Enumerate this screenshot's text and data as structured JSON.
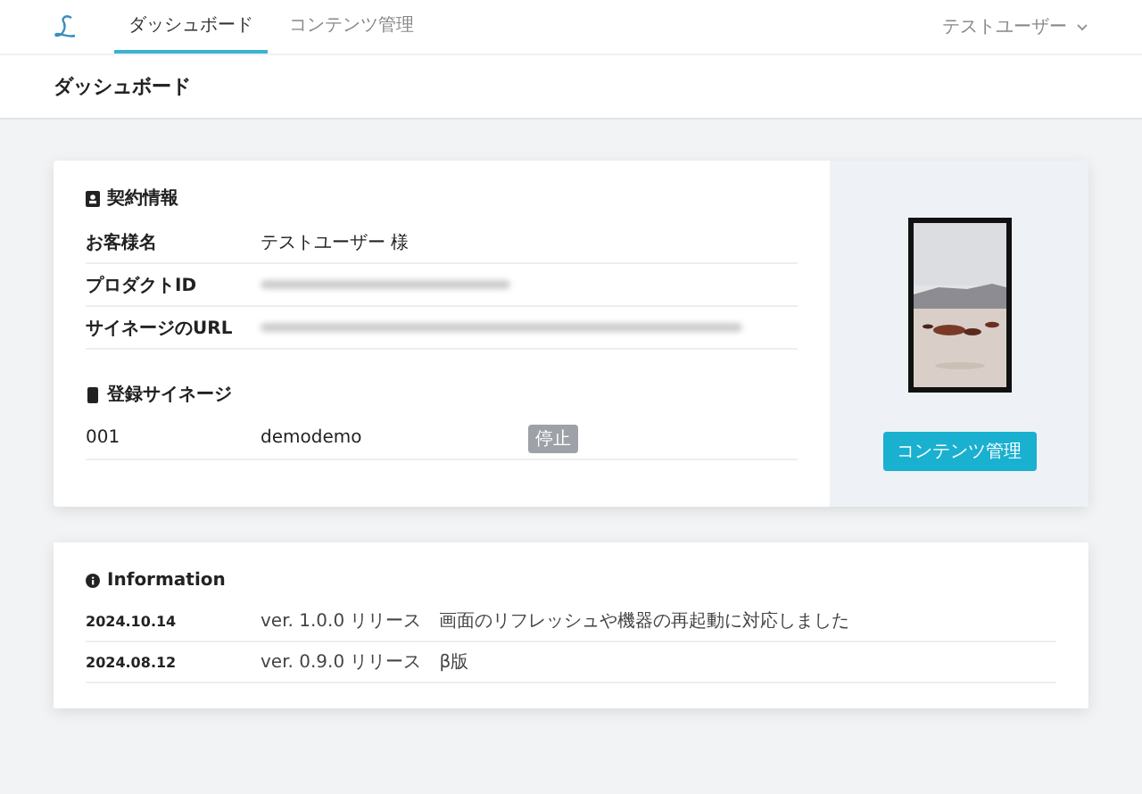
{
  "nav": {
    "tabs": [
      {
        "label": "ダッシュボード",
        "selected": true
      },
      {
        "label": "コンテンツ管理",
        "selected": false
      }
    ],
    "user_menu": {
      "label": "テストユーザー"
    }
  },
  "page_title": "ダッシュボード",
  "contract": {
    "title": "契約情報",
    "rows": [
      {
        "label": "お客様名",
        "value": "テストユーザー 様"
      },
      {
        "label": "プロダクトID",
        "kind": "redacted"
      },
      {
        "label": "サイネージのURL",
        "kind": "redacted"
      }
    ]
  },
  "signage": {
    "title": "登録サイネージ",
    "rows": [
      {
        "number": "001",
        "name": "demodemo",
        "status": "停止"
      }
    ]
  },
  "preview": {
    "kind": "picture",
    "button": "コンテンツ管理"
  },
  "information": {
    "title": "Information",
    "rows": [
      {
        "date": "2024.10.14",
        "text": "ver. 1.0.0 リリース　画面のリフレッシュや機器の再起動に対応しました"
      },
      {
        "date": "2024.08.12",
        "text": "ver. 0.9.0 リリース　β版"
      }
    ]
  }
}
